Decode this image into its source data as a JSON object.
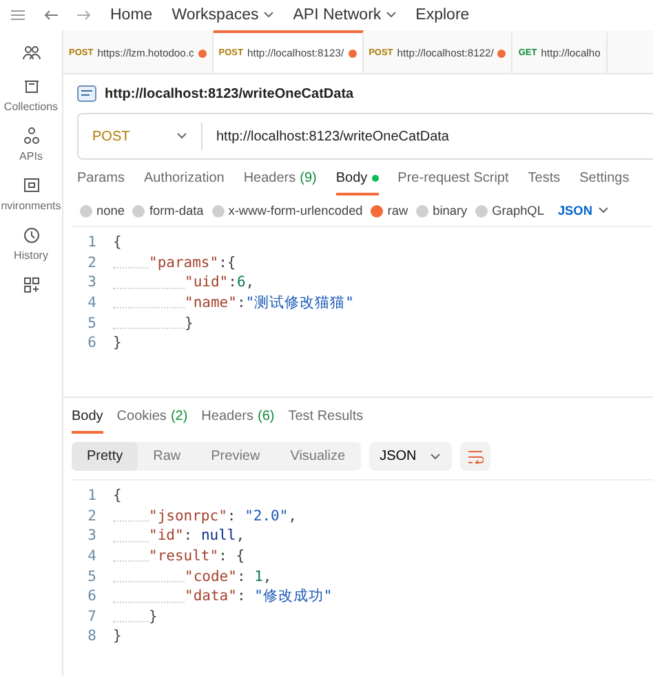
{
  "nav": {
    "items": [
      {
        "label": "Home",
        "dropdown": false
      },
      {
        "label": "Workspaces",
        "dropdown": true
      },
      {
        "label": "API Network",
        "dropdown": true
      },
      {
        "label": "Explore",
        "dropdown": false
      }
    ]
  },
  "sidebar": {
    "items": [
      {
        "label": "Collections"
      },
      {
        "label": "APIs"
      },
      {
        "label": "nvironments"
      },
      {
        "label": "History"
      }
    ]
  },
  "request_tabs": [
    {
      "method": "POST",
      "url": "https://lzm.hotodoo.c",
      "selected": false,
      "unsaved": true
    },
    {
      "method": "POST",
      "url": "http://localhost:8123/",
      "selected": true,
      "unsaved": true
    },
    {
      "method": "POST",
      "url": "http://localhost:8122/",
      "selected": false,
      "unsaved": true
    },
    {
      "method": "GET",
      "url": "http://localho",
      "selected": false,
      "unsaved": false
    }
  ],
  "request": {
    "title": "http://localhost:8123/writeOneCatData",
    "method": "POST",
    "url": "http://localhost:8123/writeOneCatData"
  },
  "request_sections": [
    {
      "label": "Params",
      "selected": false,
      "dot": false
    },
    {
      "label": "Authorization",
      "selected": false,
      "dot": false
    },
    {
      "label": "Headers",
      "count": "(9)",
      "selected": false,
      "dot": false
    },
    {
      "label": "Body",
      "selected": true,
      "dot": true
    },
    {
      "label": "Pre-request Script",
      "selected": false,
      "dot": false
    },
    {
      "label": "Tests",
      "selected": false,
      "dot": false
    },
    {
      "label": "Settings",
      "selected": false,
      "dot": false
    }
  ],
  "body_types": [
    {
      "label": "none",
      "selected": false
    },
    {
      "label": "form-data",
      "selected": false
    },
    {
      "label": "x-www-form-urlencoded",
      "selected": false
    },
    {
      "label": "raw",
      "selected": true
    },
    {
      "label": "binary",
      "selected": false
    },
    {
      "label": "GraphQL",
      "selected": false
    }
  ],
  "body_format": "JSON",
  "request_body": [
    {
      "number": "1",
      "kind": "outer",
      "tokens": [
        {
          "kind": "punct",
          "text": "{"
        }
      ]
    },
    {
      "number": "2",
      "kind": "inner",
      "tokens": [
        {
          "kind": "key",
          "text": "\"params\""
        },
        {
          "kind": "punct",
          "text": ":{"
        }
      ]
    },
    {
      "number": "3",
      "kind": "deep",
      "tokens": [
        {
          "kind": "key",
          "text": "\"uid\""
        },
        {
          "kind": "punct",
          "text": ":"
        },
        {
          "kind": "number",
          "text": "6"
        },
        {
          "kind": "punct",
          "text": ","
        }
      ]
    },
    {
      "number": "4",
      "kind": "deep",
      "tokens": [
        {
          "kind": "key",
          "text": "\"name\""
        },
        {
          "kind": "punct",
          "text": ":"
        },
        {
          "kind": "string",
          "text": "\"测试修改猫猫\""
        }
      ]
    },
    {
      "number": "5",
      "kind": "deep",
      "tokens": [
        {
          "kind": "punct",
          "text": "}"
        }
      ]
    },
    {
      "number": "6",
      "kind": "outer",
      "tokens": [
        {
          "kind": "punct",
          "text": "}"
        }
      ]
    }
  ],
  "response_tabs": [
    {
      "label": "Body",
      "selected": true
    },
    {
      "label": "Cookies",
      "count": "(2)",
      "selected": false
    },
    {
      "label": "Headers",
      "count": "(6)",
      "selected": false
    },
    {
      "label": "Test Results",
      "selected": false
    }
  ],
  "view_modes": [
    {
      "label": "Pretty",
      "selected": true
    },
    {
      "label": "Raw",
      "selected": false
    },
    {
      "label": "Preview",
      "selected": false
    },
    {
      "label": "Visualize",
      "selected": false
    }
  ],
  "response_format": "JSON",
  "response_body": [
    {
      "number": "1",
      "kind": "outer",
      "tokens": [
        {
          "kind": "punct",
          "text": "{"
        }
      ]
    },
    {
      "number": "2",
      "kind": "inner",
      "tokens": [
        {
          "kind": "key",
          "text": "\"jsonrpc\""
        },
        {
          "kind": "punct",
          "text": ": "
        },
        {
          "kind": "string",
          "text": "\"2.0\""
        },
        {
          "kind": "punct",
          "text": ","
        }
      ]
    },
    {
      "number": "3",
      "kind": "inner",
      "tokens": [
        {
          "kind": "key",
          "text": "\"id\""
        },
        {
          "kind": "punct",
          "text": ": "
        },
        {
          "kind": "null",
          "text": "null"
        },
        {
          "kind": "punct",
          "text": ","
        }
      ]
    },
    {
      "number": "4",
      "kind": "inner",
      "tokens": [
        {
          "kind": "key",
          "text": "\"result\""
        },
        {
          "kind": "punct",
          "text": ": {"
        }
      ]
    },
    {
      "number": "5",
      "kind": "deep",
      "tokens": [
        {
          "kind": "key",
          "text": "\"code\""
        },
        {
          "kind": "punct",
          "text": ": "
        },
        {
          "kind": "number",
          "text": "1"
        },
        {
          "kind": "punct",
          "text": ","
        }
      ]
    },
    {
      "number": "6",
      "kind": "deep",
      "tokens": [
        {
          "kind": "key",
          "text": "\"data\""
        },
        {
          "kind": "punct",
          "text": ": "
        },
        {
          "kind": "string",
          "text": "\"修改成功\""
        }
      ]
    },
    {
      "number": "7",
      "kind": "inner",
      "tokens": [
        {
          "kind": "punct",
          "text": "}"
        }
      ]
    },
    {
      "number": "8",
      "kind": "outer",
      "tokens": [
        {
          "kind": "punct",
          "text": "}"
        }
      ]
    }
  ]
}
